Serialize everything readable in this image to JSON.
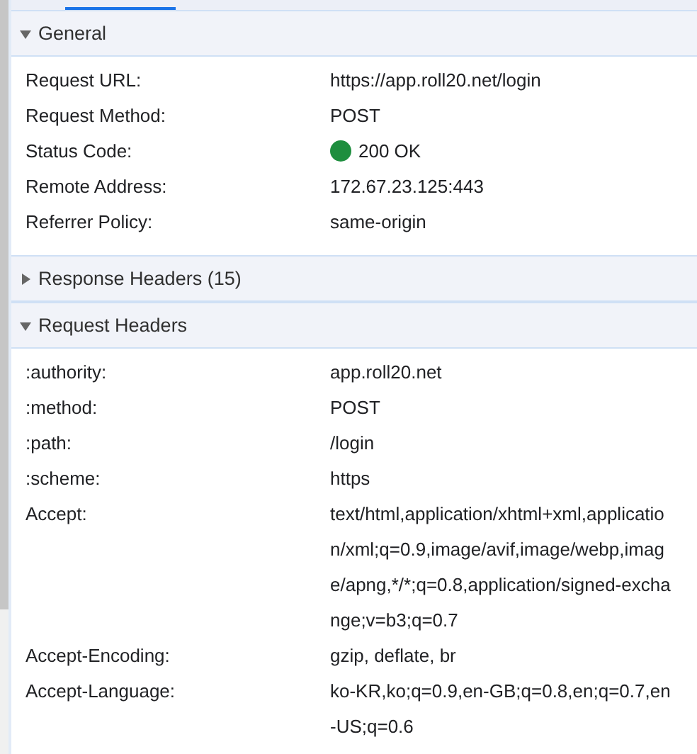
{
  "sections": [
    {
      "title": "General",
      "expanded": true,
      "rows": [
        {
          "name": "Request URL:",
          "value": "https://app.roll20.net/login",
          "kind": "text"
        },
        {
          "name": "Request Method:",
          "value": "POST",
          "kind": "text"
        },
        {
          "name": "Status Code:",
          "value": "200 OK",
          "kind": "status",
          "color": "#1e8e3e"
        },
        {
          "name": "Remote Address:",
          "value": "172.67.23.125:443",
          "kind": "text"
        },
        {
          "name": "Referrer Policy:",
          "value": "same-origin",
          "kind": "text"
        }
      ]
    },
    {
      "title": "Response Headers (15)",
      "expanded": false
    },
    {
      "title": "Request Headers",
      "expanded": true,
      "rows": [
        {
          "name": ":authority:",
          "value": "app.roll20.net",
          "kind": "text"
        },
        {
          "name": ":method:",
          "value": "POST",
          "kind": "text"
        },
        {
          "name": ":path:",
          "value": "/login",
          "kind": "text"
        },
        {
          "name": ":scheme:",
          "value": "https",
          "kind": "text"
        },
        {
          "name": "Accept:",
          "value": "text/html,application/xhtml+xml,application/xml;q=0.9,image/avif,image/webp,image/apng,*/*;q=0.8,application/signed-exchange;v=b3;q=0.7",
          "kind": "text"
        },
        {
          "name": "Accept-Encoding:",
          "value": "gzip, deflate, br",
          "kind": "text"
        },
        {
          "name": "Accept-Language:",
          "value": "ko-KR,ko;q=0.9,en-GB;q=0.8,en;q=0.7,en-US;q=0.6",
          "kind": "text"
        }
      ]
    }
  ]
}
